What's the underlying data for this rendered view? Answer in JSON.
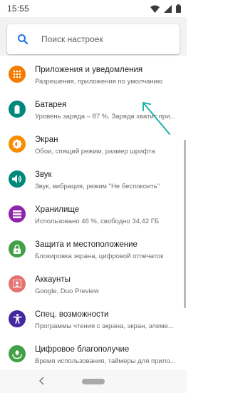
{
  "status_bar": {
    "time": "15:55",
    "icons": [
      "wifi-icon",
      "signal-icon",
      "battery-icon"
    ]
  },
  "search": {
    "placeholder": "Поиск настроек",
    "icon": "search-icon",
    "accent_color": "#1a73e8"
  },
  "settings": [
    {
      "title": "Приложения и уведомления",
      "subtitle": "Разрешения, приложения по умолчанию",
      "icon": "apps-icon",
      "color": "#f57c00"
    },
    {
      "title": "Батарея",
      "subtitle": "Уровень заряда – 87 %. Заряда хватит при...",
      "icon": "battery-icon",
      "color": "#00897b"
    },
    {
      "title": "Экран",
      "subtitle": "Обои, спящий режим, размер шрифта",
      "icon": "brightness-icon",
      "color": "#fb8c00"
    },
    {
      "title": "Звук",
      "subtitle": "Звук, вибрация, режим \"Не беспокоить\"",
      "icon": "volume-icon",
      "color": "#00897b"
    },
    {
      "title": "Хранилище",
      "subtitle": "Использовано 46 %, свободно 34,42 ГБ",
      "icon": "storage-icon",
      "color": "#8e24aa"
    },
    {
      "title": "Защита и местоположение",
      "subtitle": "Блокировка экрана, цифровой отпечаток",
      "icon": "lock-icon",
      "color": "#43a047"
    },
    {
      "title": "Аккаунты",
      "subtitle": "Google, Duo Preview",
      "icon": "account-icon",
      "color": "#e57373"
    },
    {
      "title": "Спец. возможности",
      "subtitle": "Программы чтения с экрана, экран, элеме...",
      "icon": "accessibility-icon",
      "color": "#4527a0"
    },
    {
      "title": "Цифровое благополучие",
      "subtitle": "Время использования, таймеры для прило...",
      "icon": "wellbeing-icon",
      "color": "#43a047"
    }
  ],
  "annotation": {
    "icon": "arrow-icon",
    "color": "#20b2aa"
  },
  "nav_bar": {
    "icons": [
      "back-icon",
      "home-pill"
    ]
  }
}
